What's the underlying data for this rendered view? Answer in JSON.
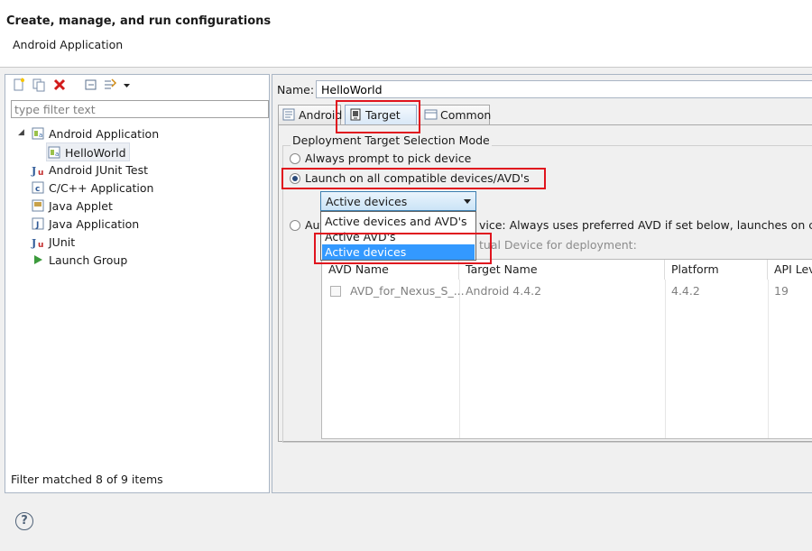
{
  "dialog": {
    "title": "Create, manage, and run configurations",
    "subtitle": "Android Application"
  },
  "left_panel": {
    "toolbar_icons": [
      "new-configuration-icon",
      "duplicate-icon",
      "delete-icon",
      "collapse-all-icon",
      "filter-icon",
      "dropdown-arrow-icon"
    ],
    "filter_placeholder": "type filter text",
    "tree": [
      {
        "label": "Android Application",
        "icon": "android-app-icon",
        "expanded": true
      },
      {
        "label": "HelloWorld",
        "icon": "android-app-icon",
        "selected": true
      },
      {
        "label": "Android JUnit Test",
        "icon": "junit-icon"
      },
      {
        "label": "C/C++ Application",
        "icon": "c-app-icon"
      },
      {
        "label": "Java Applet",
        "icon": "java-applet-icon"
      },
      {
        "label": "Java Application",
        "icon": "java-app-icon"
      },
      {
        "label": "JUnit",
        "icon": "junit-icon"
      },
      {
        "label": "Launch Group",
        "icon": "launch-group-icon"
      }
    ],
    "status": "Filter matched 8 of 9 items"
  },
  "right_panel": {
    "name_label": "Name:",
    "name_value": "HelloWorld",
    "tabs": [
      {
        "label": "Android"
      },
      {
        "label": "Target",
        "active": true
      },
      {
        "label": "Common"
      }
    ],
    "group_title": "Deployment Target Selection Mode",
    "options": {
      "always_prompt": "Always prompt to pick device",
      "launch_all": "Launch on all compatible devices/AVD's",
      "automatic_prefix": "Aut",
      "automatic_suffix": "vice: Always uses preferred AVD if set below, launches on comp",
      "select_hint": "tual Device for deployment:"
    },
    "combo": {
      "selected": "Active devices",
      "options": [
        "Active devices and AVD's",
        "Active AVD's",
        "Active devices"
      ]
    },
    "avd_table": {
      "columns": [
        "AVD Name",
        "Target Name",
        "Platform",
        "API Lev"
      ],
      "rows": [
        {
          "name": "AVD_for_Nexus_S_...",
          "target": "Android 4.4.2",
          "platform": "4.4.2",
          "api": "19"
        }
      ]
    }
  },
  "help_symbol": "?"
}
